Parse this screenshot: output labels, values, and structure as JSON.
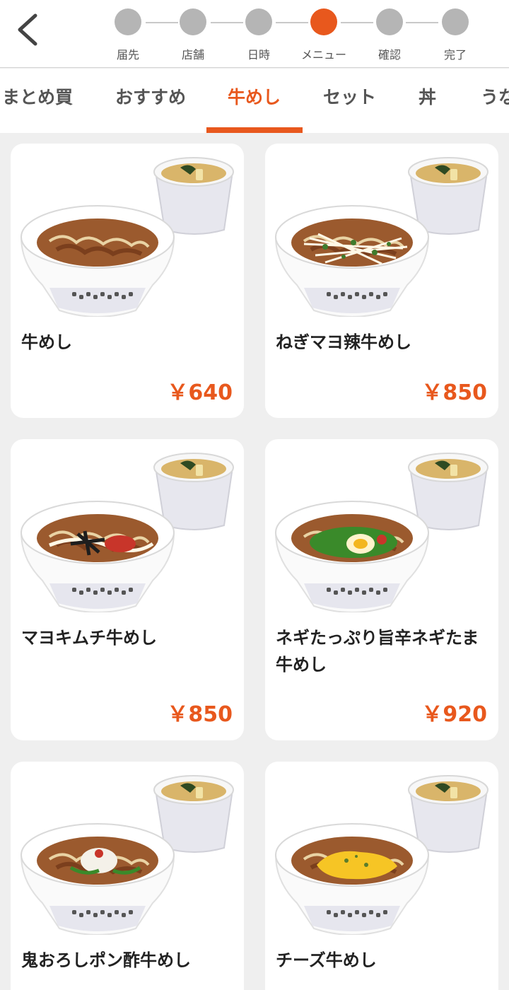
{
  "stepper": {
    "steps": [
      {
        "label": "届先",
        "state": "done"
      },
      {
        "label": "店舗",
        "state": "done"
      },
      {
        "label": "日時",
        "state": "done"
      },
      {
        "label": "メニュー",
        "state": "current"
      },
      {
        "label": "確認",
        "state": "pending"
      },
      {
        "label": "完了",
        "state": "pending"
      }
    ]
  },
  "tabs": [
    {
      "label": "まとめ買",
      "active": false
    },
    {
      "label": "おすすめ",
      "active": false
    },
    {
      "label": "牛めし",
      "active": true
    },
    {
      "label": "セット",
      "active": false
    },
    {
      "label": "丼",
      "active": false
    },
    {
      "label": "うな",
      "active": false
    }
  ],
  "products": [
    {
      "name": "牛めし",
      "price": "￥640",
      "topping": "plain"
    },
    {
      "name": "ねぎマヨ辣牛めし",
      "price": "￥850",
      "topping": "negi-mayo"
    },
    {
      "name": "マヨキムチ牛めし",
      "price": "￥850",
      "topping": "mayo-kimchi"
    },
    {
      "name": "ネギたっぷり旨辛ネギたま牛めし",
      "price": "￥920",
      "topping": "negi-tama"
    },
    {
      "name": "鬼おろしポン酢牛めし",
      "price": "",
      "topping": "oroshi"
    },
    {
      "name": "チーズ牛めし",
      "price": "",
      "topping": "cheese"
    }
  ],
  "colors": {
    "accent": "#e8581d",
    "step_inactive": "#b5b5b5",
    "background": "#efefef"
  }
}
